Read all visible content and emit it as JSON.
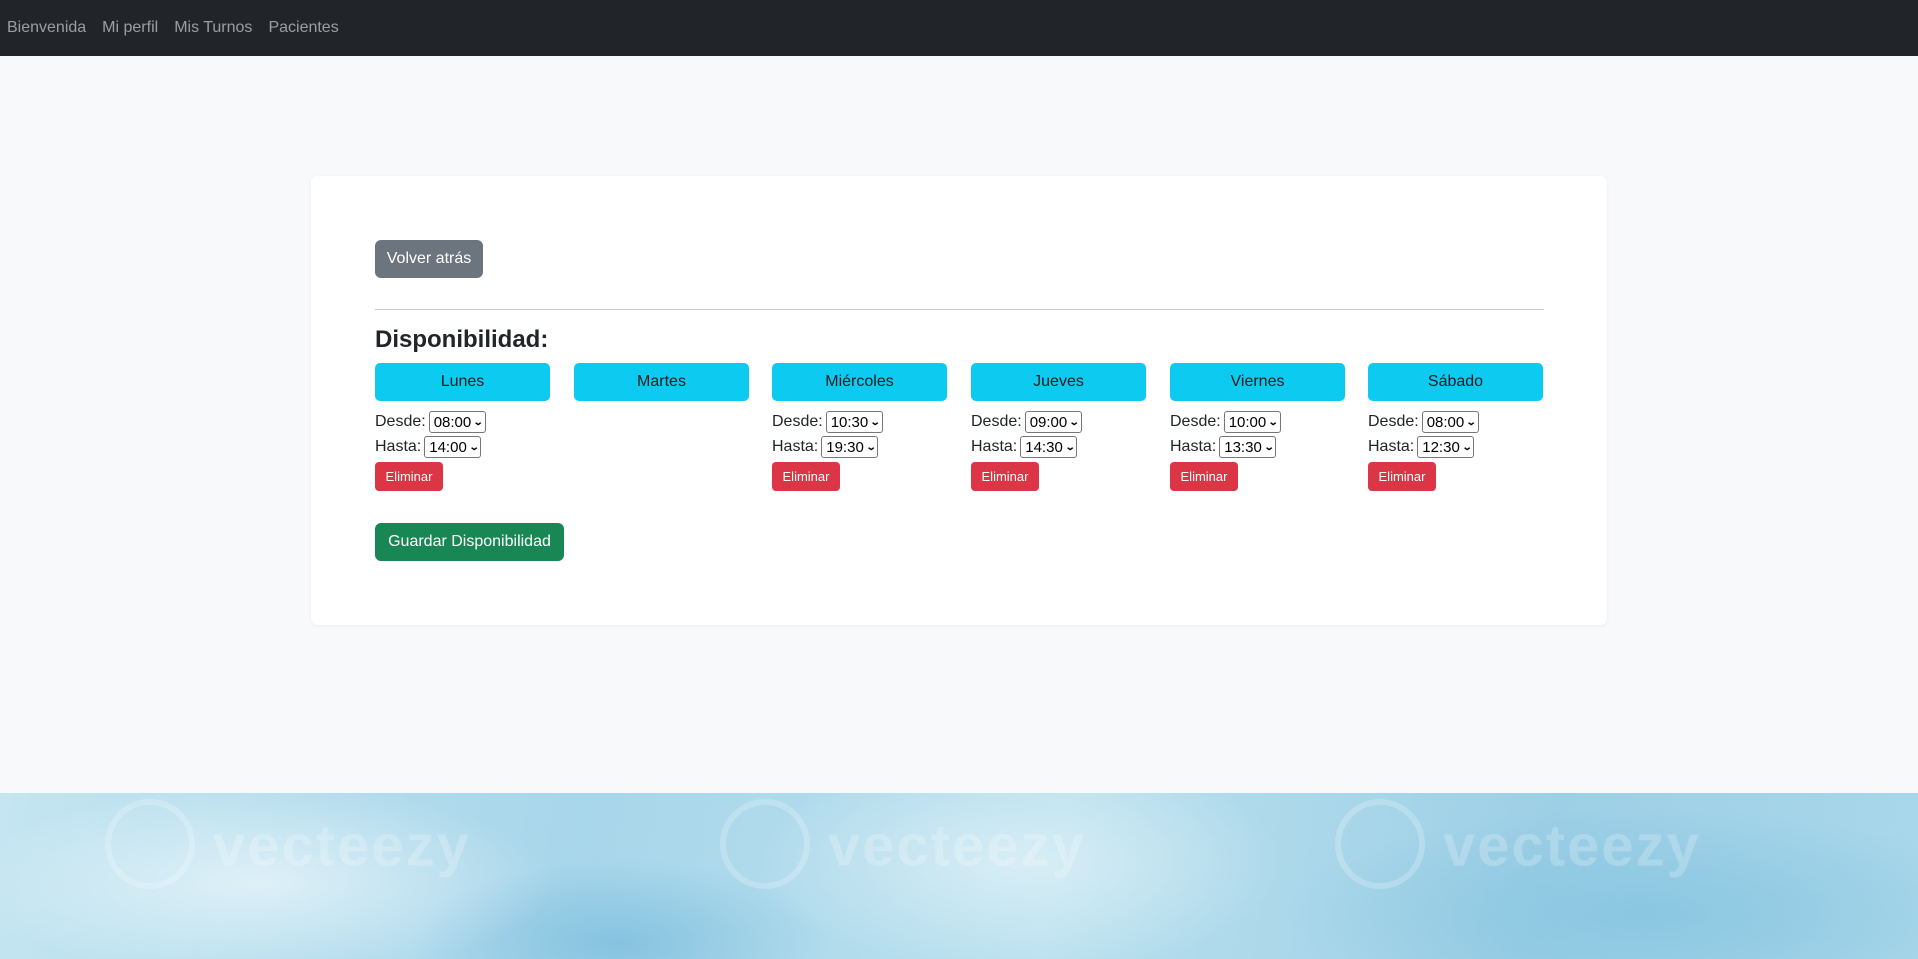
{
  "nav": {
    "items": [
      "Bienvenida",
      "Mi perfil",
      "Mis Turnos",
      "Pacientes"
    ]
  },
  "back_button_label": "Volver atrás",
  "section_title": "Disponibilidad:",
  "labels": {
    "from": "Desde:",
    "to": "Hasta:",
    "delete": "Eliminar"
  },
  "days": [
    {
      "name": "Lunes",
      "from": "08:00",
      "to": "14:00"
    },
    {
      "name": "Martes"
    },
    {
      "name": "Miércoles",
      "from": "10:30",
      "to": "19:30"
    },
    {
      "name": "Jueves",
      "from": "09:00",
      "to": "14:30"
    },
    {
      "name": "Viernes",
      "from": "10:00",
      "to": "13:30"
    },
    {
      "name": "Sábado",
      "from": "08:00",
      "to": "12:30"
    }
  ],
  "save_button_label": "Guardar Disponibilidad",
  "watermark_text": "vecteezy",
  "colors": {
    "navbar": "#212529",
    "day_button": "#0dcaf0",
    "delete_button": "#dc3545",
    "save_button": "#198754",
    "back_button": "#6c757d"
  }
}
